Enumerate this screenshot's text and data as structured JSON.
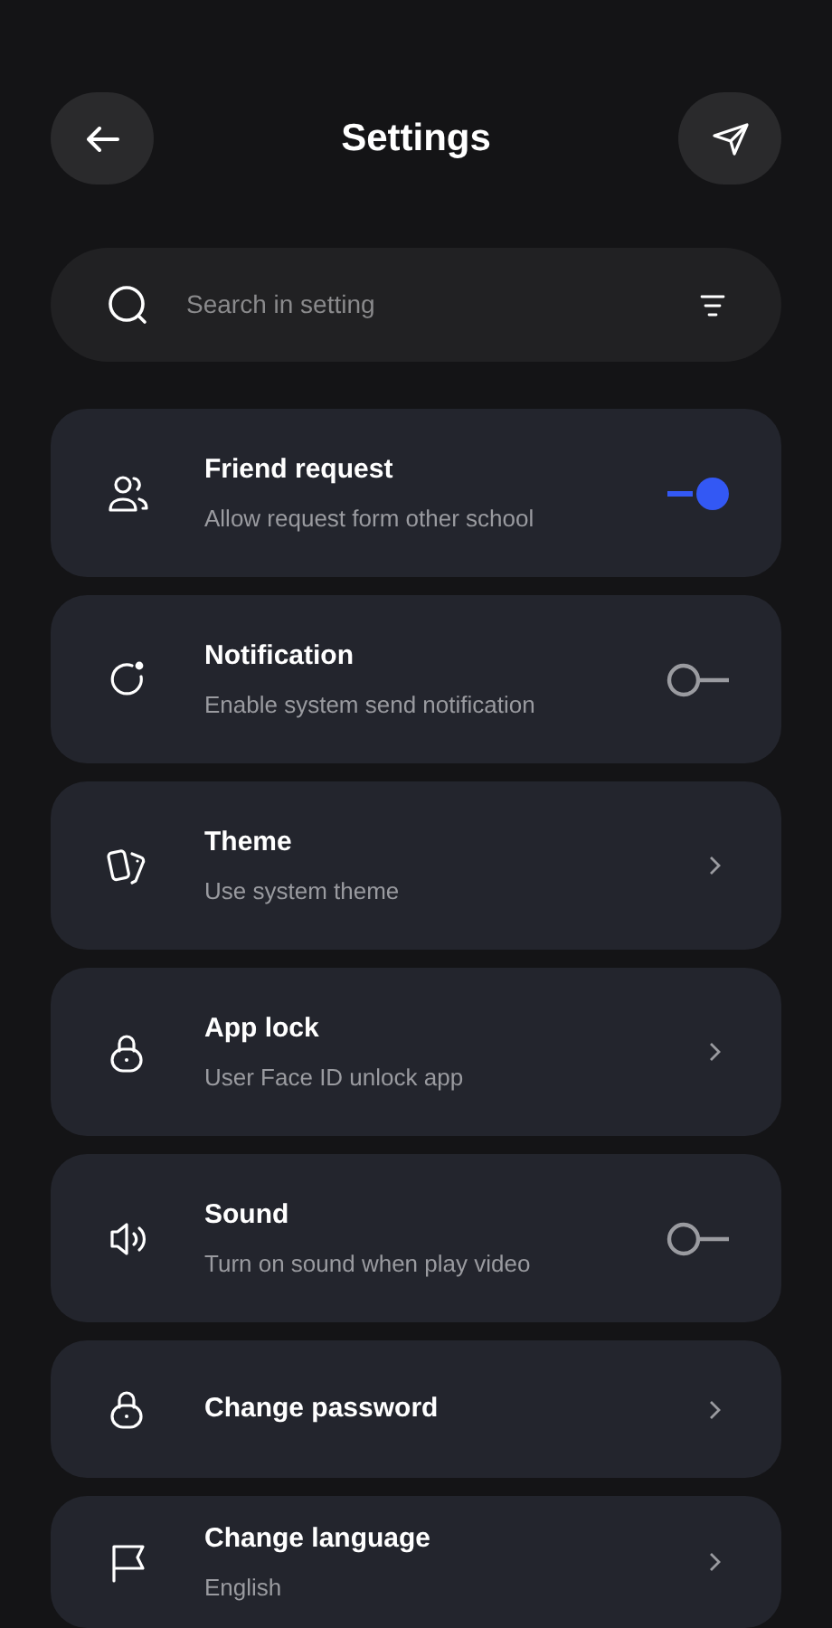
{
  "header": {
    "title": "Settings"
  },
  "search": {
    "placeholder": "Search in setting"
  },
  "items": [
    {
      "kind": "toggle",
      "title": "Friend request",
      "subtitle": "Allow request form other school",
      "on": true
    },
    {
      "kind": "toggle",
      "title": "Notification",
      "subtitle": "Enable system  send notification",
      "on": false
    },
    {
      "kind": "link",
      "title": "Theme",
      "subtitle": "Use system theme"
    },
    {
      "kind": "link",
      "title": "App lock",
      "subtitle": "User Face ID unlock app"
    },
    {
      "kind": "toggle",
      "title": "Sound",
      "subtitle": "Turn on sound when play video",
      "on": false
    },
    {
      "kind": "link",
      "title": "Change password"
    },
    {
      "kind": "link",
      "title": "Change language",
      "subtitle": "English"
    }
  ]
}
